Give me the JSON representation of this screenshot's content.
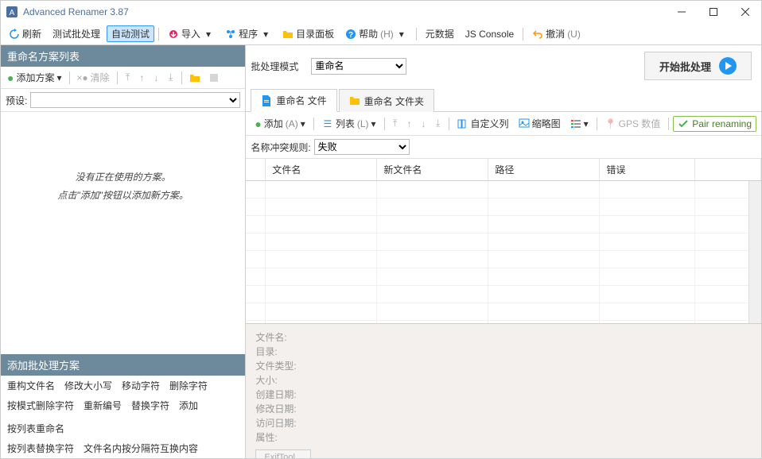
{
  "titlebar": {
    "title": "Advanced Renamer 3.87"
  },
  "toolbar": {
    "refresh": "刷新",
    "test_batch": "测试批处理",
    "auto_test": "自动测试",
    "import": "导入",
    "program": "程序",
    "dir_panel": "目录面板",
    "help": "帮助",
    "help_acc": "(H)",
    "metadata": "元数据",
    "js_console": "JS Console",
    "undo": "撤消",
    "undo_acc": "(U)"
  },
  "left": {
    "header": "重命名方案列表",
    "add_scheme": "添加方案",
    "clear": "清除",
    "preset": "预设:",
    "empty1": "没有正在使用的方案。",
    "empty2": "点击\"添加\"按钮以添加新方案。",
    "add_batch_header": "添加批处理方案",
    "links": [
      "重构文件名",
      "修改大小写",
      "移动字符",
      "删除字符",
      "按模式删除字符",
      "重新编号",
      "替换字符",
      "添加",
      "按列表重命名",
      "按列表替换字符",
      "文件名内按分隔符互换内容"
    ]
  },
  "right": {
    "mode_label": "批处理模式",
    "mode_value": "重命名",
    "start": "开始批处理",
    "tab_files": "重命名 文件",
    "tab_folders": "重命名 文件夹",
    "add": "添加",
    "add_acc": "(A)",
    "list": "列表",
    "list_acc": "(L)",
    "custom_cols": "自定义列",
    "thumbnails": "缩略图",
    "gps": "GPS 数值",
    "pair": "Pair renaming",
    "conflict_label": "名称冲突规则:",
    "conflict_value": "失败",
    "columns": [
      "",
      "文件名",
      "新文件名",
      "路径",
      "错误",
      ""
    ],
    "details": {
      "filename": "文件名:",
      "dir": "目录:",
      "type": "文件类型:",
      "size": "大小:",
      "created": "创建日期:",
      "modified": "修改日期:",
      "accessed": "访问日期:",
      "attrs": "属性:",
      "exif": "ExifTool..."
    }
  }
}
